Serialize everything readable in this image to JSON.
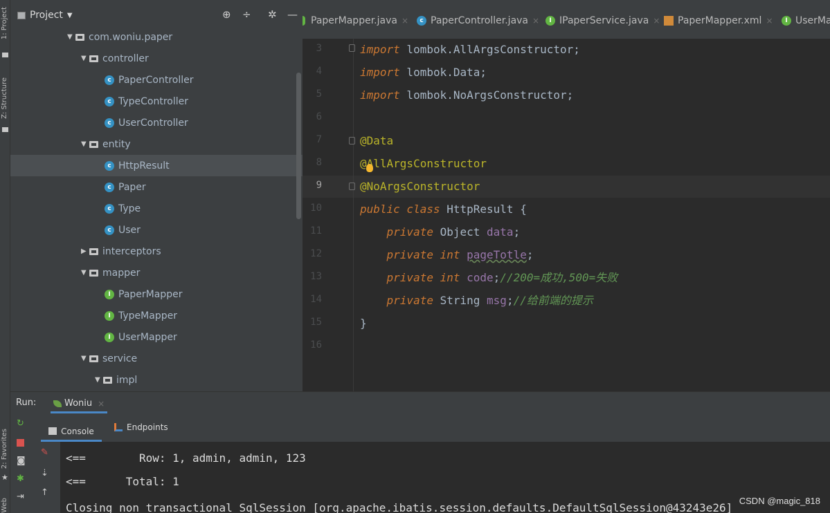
{
  "left_strip": {
    "project": "1: Project",
    "structure": "Z: Structure",
    "favorites": "2: Favorites",
    "web": "Web"
  },
  "project_panel": {
    "title": "Project",
    "tree": [
      {
        "label": "com.woniu.paper",
        "kind": "package",
        "depth": 0,
        "expanded": true
      },
      {
        "label": "controller",
        "kind": "package",
        "depth": 1,
        "expanded": true
      },
      {
        "label": "PaperController",
        "kind": "class",
        "depth": 2
      },
      {
        "label": "TypeController",
        "kind": "class",
        "depth": 2
      },
      {
        "label": "UserController",
        "kind": "class",
        "depth": 2
      },
      {
        "label": "entity",
        "kind": "package",
        "depth": 1,
        "expanded": true
      },
      {
        "label": "HttpResult",
        "kind": "class",
        "depth": 2,
        "selected": true
      },
      {
        "label": "Paper",
        "kind": "class",
        "depth": 2
      },
      {
        "label": "Type",
        "kind": "class",
        "depth": 2
      },
      {
        "label": "User",
        "kind": "class",
        "depth": 2
      },
      {
        "label": "interceptors",
        "kind": "package",
        "depth": 1,
        "expanded": false
      },
      {
        "label": "mapper",
        "kind": "package",
        "depth": 1,
        "expanded": true
      },
      {
        "label": "PaperMapper",
        "kind": "interface",
        "depth": 2
      },
      {
        "label": "TypeMapper",
        "kind": "interface",
        "depth": 2
      },
      {
        "label": "UserMapper",
        "kind": "interface",
        "depth": 2
      },
      {
        "label": "service",
        "kind": "package",
        "depth": 1,
        "expanded": true
      },
      {
        "label": "impl",
        "kind": "package",
        "depth": 2,
        "expanded": true
      }
    ]
  },
  "tabs": [
    {
      "label": "PaperMapper.java",
      "kind": "interface"
    },
    {
      "label": "PaperController.java",
      "kind": "class"
    },
    {
      "label": "IPaperService.java",
      "kind": "interface"
    },
    {
      "label": "PaperMapper.xml",
      "kind": "xml"
    },
    {
      "label": "UserMa",
      "kind": "interface"
    }
  ],
  "editor": {
    "line_numbers": [
      "3",
      "4",
      "5",
      "6",
      "7",
      "8",
      "9",
      "10",
      "11",
      "12",
      "13",
      "14",
      "15",
      "16"
    ],
    "current_line": "9"
  },
  "run_panel": {
    "label": "Run:",
    "config": "Woniu",
    "console_tab": "Console",
    "endpoints_tab": "Endpoints",
    "lines": [
      "<==        Row: 1, admin, admin, 123",
      "<==      Total: 1",
      "Closing non transactional SqlSession [org.apache.ibatis.session.defaults.DefaultSqlSession@43243e26]"
    ]
  },
  "watermark": "CSDN @magic_818"
}
